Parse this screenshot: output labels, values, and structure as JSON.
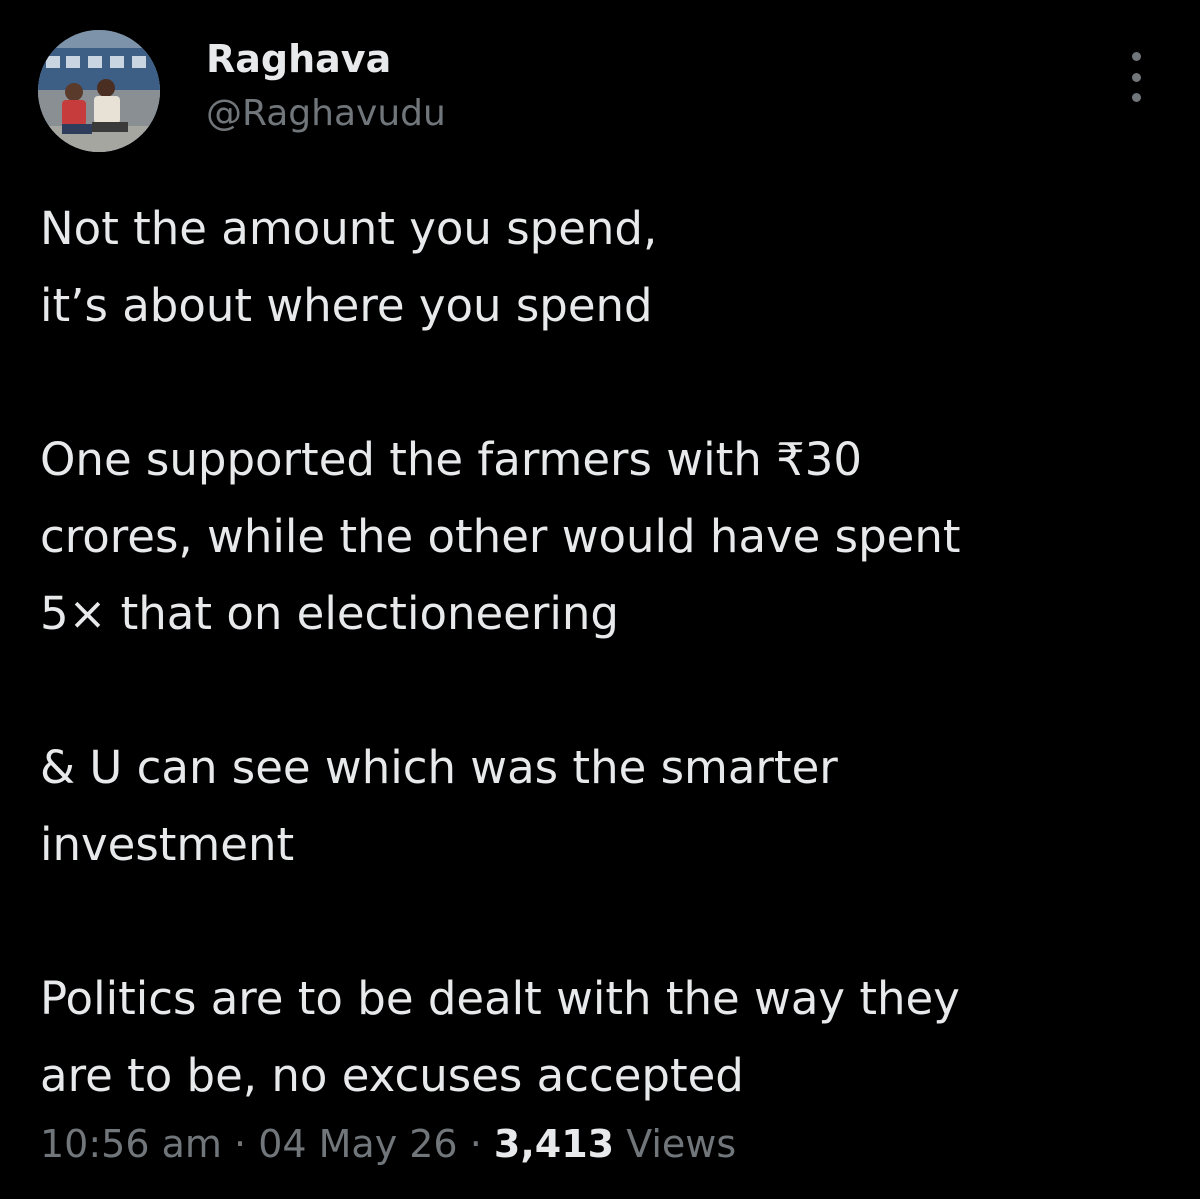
{
  "author": {
    "display_name": "Raghava",
    "handle": "@Raghavudu"
  },
  "menu": {
    "icon": "more-vertical-icon"
  },
  "tweet": {
    "paragraphs": [
      [
        "Not the amount you spend,",
        "it’s about where you spend"
      ],
      [
        "One supported the farmers with ₹30",
        "crores, while the other would have spent",
        "5× that on electioneering"
      ],
      [
        "& U can see which was the smarter",
        "investment"
      ],
      [
        "Politics are to be dealt with the way they",
        "are to be, no excuses accepted"
      ]
    ]
  },
  "meta": {
    "time": "10:56 am",
    "separator": "·",
    "date": "04 May 26",
    "views_count": "3,413",
    "views_label": "Views"
  },
  "colors": {
    "background": "#000000",
    "primary_text": "#e7e9ea",
    "secondary_text": "#71767b"
  }
}
